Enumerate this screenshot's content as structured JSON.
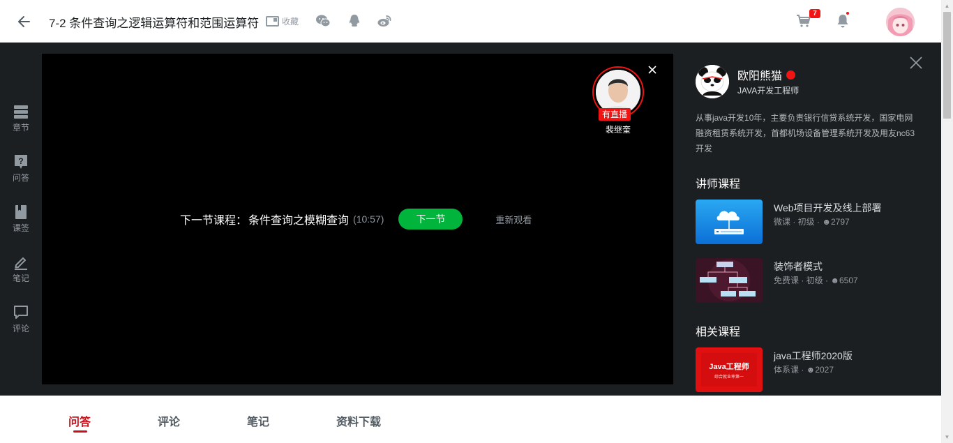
{
  "header": {
    "title": "7-2 条件查询之逻辑运算符和范围运算符",
    "favorite_label": "收藏",
    "cart_count": "7"
  },
  "side_nav": {
    "items": [
      {
        "label": "章节",
        "icon": "chapter-icon"
      },
      {
        "label": "问答",
        "icon": "question-icon"
      },
      {
        "label": "课签",
        "icon": "bookmark-icon"
      },
      {
        "label": "笔记",
        "icon": "note-icon"
      },
      {
        "label": "评论",
        "icon": "comment-icon"
      }
    ]
  },
  "player": {
    "next_prefix": "下一节课程：",
    "next_name": "条件查询之模糊查询",
    "next_duration": "(10:57)",
    "next_button": "下一节",
    "replay_label": "重新观看",
    "live_tag": "有直播",
    "live_name": "裴继奎"
  },
  "teacher": {
    "name": "欧阳熊猫",
    "job": "JAVA开发工程师",
    "description": "从事java开发10年，主要负责银行信贷系统开发，国家电网融资租赁系统开发，首都机场设备管理系统开发及用友nc63开发"
  },
  "teacher_courses": {
    "title": "讲师课程",
    "items": [
      {
        "title": "Web项目开发及线上部署",
        "meta": "微课 · 初级 · ",
        "count": "2797"
      },
      {
        "title": "装饰者模式",
        "meta": "免费课 · 初级 · ",
        "count": "6507"
      }
    ]
  },
  "related_courses": {
    "title": "相关课程",
    "items": [
      {
        "title": "java工程师2020版",
        "meta": "体系课 · ",
        "count": "2027",
        "thumb_title": "Java工程师",
        "thumb_sub": "综合就业率第一"
      }
    ]
  },
  "tabs": [
    "问答",
    "评论",
    "笔记",
    "资料下载"
  ],
  "colors": {
    "accent_red": "#c9111b",
    "green": "#00b43c",
    "dark_bg": "#1c1f21"
  }
}
